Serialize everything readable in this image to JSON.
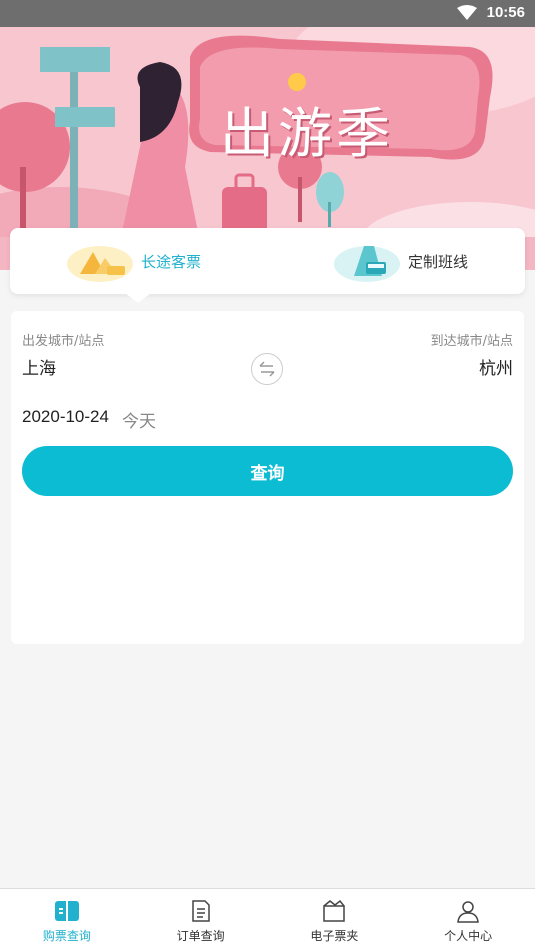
{
  "status_bar": {
    "time": "10:56"
  },
  "banner": {
    "title": "出游季"
  },
  "tabs": [
    {
      "label": "长途客票",
      "active": true
    },
    {
      "label": "定制班线",
      "active": false
    }
  ],
  "form": {
    "from_label": "出发城市/站点",
    "from_city": "上海",
    "to_label": "到达城市/站点",
    "to_city": "杭州",
    "date": "2020-10-24",
    "day": "今天",
    "search_label": "查询"
  },
  "bottom_nav": [
    {
      "label": "购票查询",
      "icon": "ticket-icon",
      "active": true
    },
    {
      "label": "订单查询",
      "icon": "order-document-icon",
      "active": false
    },
    {
      "label": "电子票夹",
      "icon": "ticket-folder-icon",
      "active": false
    },
    {
      "label": "个人中心",
      "icon": "person-icon",
      "active": false
    }
  ],
  "colors": {
    "accent": "#0bbcd3",
    "status_bar": "#6e6e6e",
    "banner_bg": "#f7c6cf"
  }
}
